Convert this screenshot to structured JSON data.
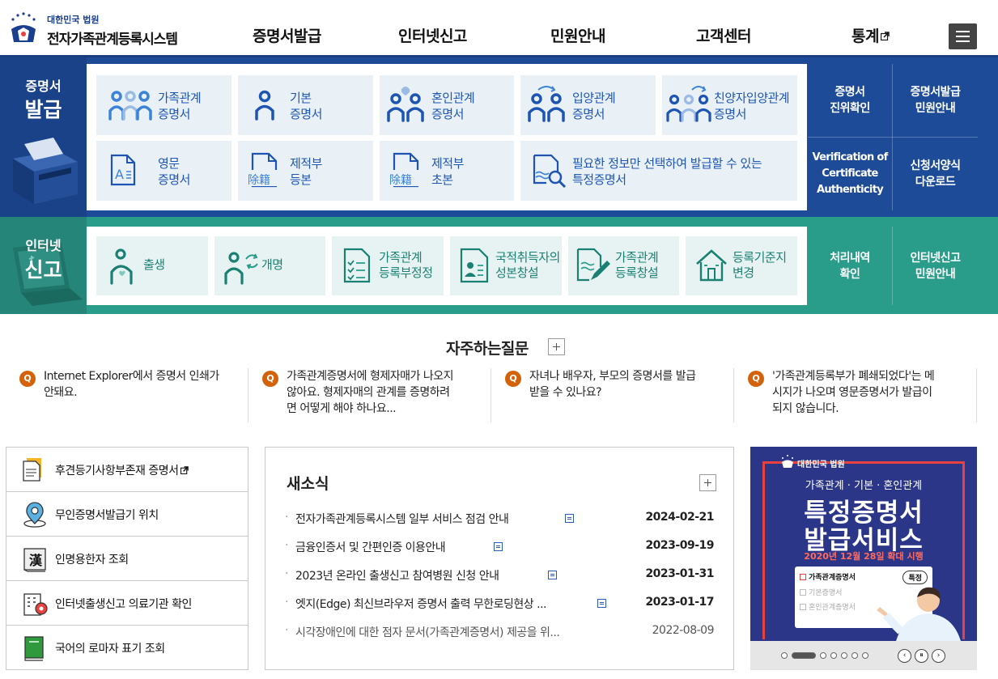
{
  "header": {
    "logo_small": "대한민국 법원",
    "logo_big": "전자가족관계등록시스템",
    "nav": [
      {
        "label": "증명서발급"
      },
      {
        "label": "인터넷신고"
      },
      {
        "label": "민원안내"
      },
      {
        "label": "고객센터"
      },
      {
        "label": "통계",
        "external": true
      }
    ],
    "menu_icon": "hamburger-icon"
  },
  "certificate": {
    "label_small": "증명서",
    "label_big": "발급",
    "tiles": [
      {
        "line1": "가족관계",
        "line2": "증명서",
        "icon": "family-icon"
      },
      {
        "line1": "기본",
        "line2": "증명서",
        "icon": "person-icon"
      },
      {
        "line1": "혼인관계",
        "line2": "증명서",
        "icon": "marriage-icon"
      },
      {
        "line1": "입양관계",
        "line2": "증명서",
        "icon": "adoption-icon"
      },
      {
        "line1": "친양자입양관계",
        "line2": "증명서",
        "icon": "full-adoption-icon"
      },
      {
        "line1": "영문",
        "line2": "증명서",
        "icon": "english-doc-icon"
      },
      {
        "line1": "제적부",
        "line2": "등본",
        "icon": "removed-register-icon",
        "badge": "除籍"
      },
      {
        "line1": "제적부",
        "line2": "초본",
        "icon": "removed-register-icon",
        "badge": "除籍"
      },
      {
        "line1": "필요한 정보만 선택하여 발급할 수 있는",
        "line2": "특정증명서",
        "icon": "search-doc-icon"
      }
    ],
    "side": [
      {
        "line1": "증명서",
        "line2": "진위확인"
      },
      {
        "line1": "증명서발급",
        "line2": "민원안내"
      },
      {
        "line1": "Verification of",
        "line2": "Certificate",
        "line3": "Authenticity"
      },
      {
        "line1": "신청서양식",
        "line2": "다운로드"
      }
    ]
  },
  "internet": {
    "label_small": "인터넷",
    "label_big": "신고",
    "tiles": [
      {
        "line1": "출생",
        "line2": "",
        "icon": "birth-icon"
      },
      {
        "line1": "개명",
        "line2": "",
        "icon": "rename-icon"
      },
      {
        "line1": "가족관계",
        "line2": "등록부정정",
        "icon": "checklist-icon"
      },
      {
        "line1": "국적취득자의",
        "line2": "성본창설",
        "icon": "id-card-icon"
      },
      {
        "line1": "가족관계",
        "line2": "등록창설",
        "icon": "edit-doc-icon"
      },
      {
        "line1": "등록기준지",
        "line2": "변경",
        "icon": "house-icon"
      }
    ],
    "side": [
      {
        "line1": "처리내역",
        "line2": "확인"
      },
      {
        "line1": "인터넷신고",
        "line2": "민원안내"
      }
    ]
  },
  "faq": {
    "title": "자주하는질문",
    "q_badge": "Q",
    "items": [
      {
        "line1": "Internet Explorer에서 증명서 인쇄가",
        "line2": "안돼요.",
        "line3": ""
      },
      {
        "line1": "가족관계증명서에 형제자매가 나오지",
        "line2": "않아요. 형제자매의 관계를 증명하려",
        "line3": "면 어떻게 해야 하나요..."
      },
      {
        "line1": "자녀나 배우자, 부모의 증명서를 발급",
        "line2": "받을 수 있나요?",
        "line3": ""
      },
      {
        "line1": "'가족관계등록부가 폐쇄되었다'는 메",
        "line2": "시지가 나오며 영문증명서가 발급이",
        "line3": "되지 않습니다."
      }
    ]
  },
  "quick_links": [
    {
      "label": "후견등기사항부존재 증명서",
      "icon": "document-icon",
      "external": true
    },
    {
      "label": "무인증명서발급기 위치",
      "icon": "location-icon"
    },
    {
      "label": "인명용한자 조회",
      "icon": "hanja-book-icon",
      "glyph": "漢"
    },
    {
      "label": "인터넷출생신고 의료기관 확인",
      "icon": "hospital-icon"
    },
    {
      "label": "국어의 로마자 표기 조회",
      "icon": "green-book-icon"
    }
  ],
  "news": {
    "title": "새소식",
    "items": [
      {
        "title": "전자가족관계등록시스템 일부 서비스 점검 안내",
        "date": "2024-02-21",
        "new": true
      },
      {
        "title": "금융인증서 및 간편인증 이용안내",
        "date": "2023-09-19",
        "new": true
      },
      {
        "title": "2023년 온라인 출생신고 참여병원 신청 안내",
        "date": "2023-01-31",
        "new": true
      },
      {
        "title": "엣지(Edge) 최신브라우저 증명서 출력 무한로딩현상 ...",
        "date": "2023-01-17",
        "new": true
      },
      {
        "title": "시각장애인에 대한 점자 문서(가족관계증명서) 제공을 위...",
        "date": "2022-08-09",
        "new": false
      }
    ]
  },
  "banner": {
    "court": "대한민국 법원",
    "subtitle": "가족관계 · 기본 · 혼인관계",
    "title1": "특정증명서",
    "title2": "발급서비스",
    "date_line": "2020년 12월 28일 확대 시행",
    "card": [
      {
        "label": "가족관계증명서",
        "state": "on",
        "pill": "특정"
      },
      {
        "label": "기본증명서",
        "state": "off"
      },
      {
        "label": "혼인관계증명서",
        "state": "off"
      }
    ],
    "pause_glyph": "⏸",
    "prev_glyph": "‹",
    "next_glyph": "›"
  },
  "colors": {
    "cert_band": "#1d4b98",
    "net_band": "#2a9c8a",
    "cert_text": "#1e55b3",
    "net_text": "#1a8073",
    "faq_badge": "#d4620a",
    "banner_bg": "#2c3688"
  }
}
